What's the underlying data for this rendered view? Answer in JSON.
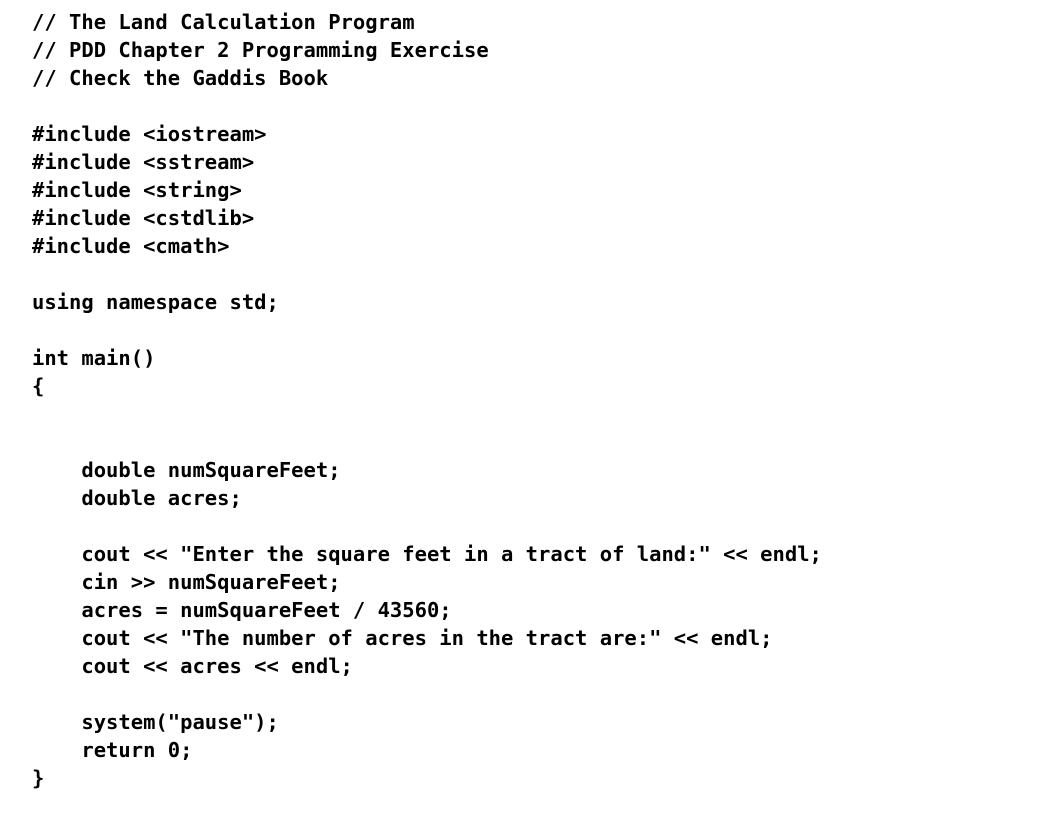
{
  "document": {
    "kind": "source-code-listing",
    "language": "C++",
    "background_color": "#ffffff",
    "text_color": "#000000",
    "lines": [
      "// The Land Calculation Program",
      "// PDD Chapter 2 Programming Exercise",
      "// Check the Gaddis Book",
      "",
      "#include <iostream>",
      "#include <sstream>",
      "#include <string>",
      "#include <cstdlib>",
      "#include <cmath>",
      "",
      "using namespace std;",
      "",
      "int main()",
      "{",
      "",
      "",
      "    double numSquareFeet;",
      "    double acres;",
      "",
      "    cout << \"Enter the square feet in a tract of land:\" << endl;",
      "    cin >> numSquareFeet;",
      "    acres = numSquareFeet / 43560;",
      "    cout << \"The number of acres in the tract are:\" << endl;",
      "    cout << acres << endl;",
      "",
      "    system(\"pause\");",
      "    return 0;",
      "}"
    ]
  }
}
